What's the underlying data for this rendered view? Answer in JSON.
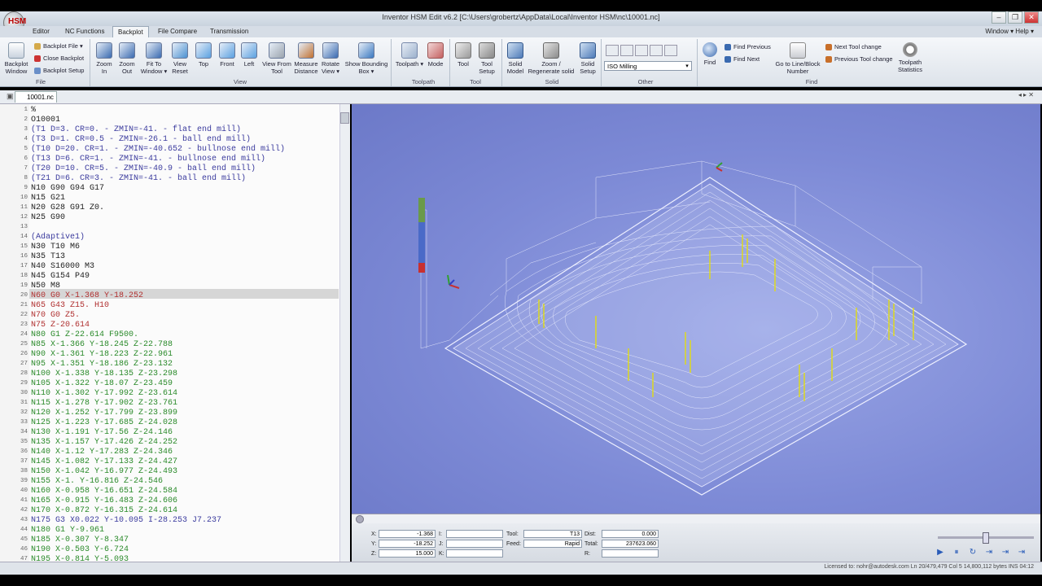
{
  "window": {
    "title": "Inventor HSM Edit v6.2    [C:\\Users\\grobertz\\AppData\\Local\\Inventor HSM\\nc\\10001.nc]",
    "controls": [
      "–",
      "❐",
      "✕"
    ]
  },
  "menu_tabs": [
    "Editor",
    "NC Functions",
    "Backplot",
    "File Compare",
    "Transmission"
  ],
  "menu_right": "Window ▾  Help ▾",
  "ribbon": {
    "file_group": {
      "label": "File",
      "backplot_window": "Backplot Window",
      "items": [
        "Backplot File ▾",
        "Close Backplot",
        "Backplot Setup"
      ]
    },
    "view_group": {
      "label": "View",
      "buttons": [
        "Zoom In",
        "Zoom Out",
        "Fit To Window ▾",
        "View Reset",
        "Top",
        "Front",
        "Left",
        "View From Tool",
        "Measure Distance",
        "Rotate View ▾",
        "Show Bounding Box ▾"
      ]
    },
    "toolpath_group": {
      "label": "Toolpath",
      "buttons": [
        "Toolpath ▾",
        "Mode"
      ]
    },
    "tool_group": {
      "label": "Tool",
      "buttons": [
        "Tool",
        "Tool Setup"
      ]
    },
    "solid_group": {
      "label": "Solid",
      "buttons": [
        "Solid Model",
        "Zoom / Regenerate solid",
        "Solid Setup"
      ]
    },
    "other_group": {
      "label": "Other",
      "combo_value": "ISO Milling"
    },
    "find_group": {
      "label": "Find",
      "buttons": [
        "Find",
        "Find Previous",
        "Find Next",
        "Go to Line/Block Number"
      ]
    },
    "toolchange_items": [
      "Next Tool change",
      "Previous Tool change"
    ],
    "stats_button": "Toolpath Statistics"
  },
  "doc_tab": "10001.nc",
  "code_lines": [
    {
      "n": "1",
      "t": "%",
      "c": "#222"
    },
    {
      "n": "2",
      "t": "O10001",
      "c": "#222"
    },
    {
      "n": "3",
      "t": "(T1 D=3. CR=0. - ZMIN=-41. - flat end mill)",
      "c": "#3b3b9e"
    },
    {
      "n": "4",
      "t": "(T3 D=1. CR=0.5 - ZMIN=-26.1 - ball end mill)",
      "c": "#3b3b9e"
    },
    {
      "n": "5",
      "t": "(T10 D=20. CR=1. - ZMIN=-40.652 - bullnose end mill)",
      "c": "#3b3b9e"
    },
    {
      "n": "6",
      "t": "(T13 D=6. CR=1. - ZMIN=-41. - bullnose end mill)",
      "c": "#3b3b9e"
    },
    {
      "n": "7",
      "t": "(T20 D=10. CR=5. - ZMIN=-40.9 - ball end mill)",
      "c": "#3b3b9e"
    },
    {
      "n": "8",
      "t": "(T21 D=6. CR=3. - ZMIN=-41. - ball end mill)",
      "c": "#3b3b9e"
    },
    {
      "n": "9",
      "t": "N10 G90 G94 G17",
      "c": "#222"
    },
    {
      "n": "10",
      "t": "N15 G21",
      "c": "#222"
    },
    {
      "n": "11",
      "t": "N20 G28 G91 Z0.",
      "c": "#222"
    },
    {
      "n": "12",
      "t": "N25 G90",
      "c": "#222"
    },
    {
      "n": "13",
      "t": "",
      "c": "#222"
    },
    {
      "n": "14",
      "t": "(Adaptive1)",
      "c": "#3b3b9e"
    },
    {
      "n": "15",
      "t": "N30 T10 M6",
      "c": "#222"
    },
    {
      "n": "16",
      "t": "N35 T13",
      "c": "#222"
    },
    {
      "n": "17",
      "t": "N40 S16000 M3",
      "c": "#222"
    },
    {
      "n": "18",
      "t": "N45 G154 P49",
      "c": "#222"
    },
    {
      "n": "19",
      "t": "N50 M8",
      "c": "#222"
    },
    {
      "n": "20",
      "t": "N60 G0 X-1.368 Y-18.252",
      "c": "#b03030"
    },
    {
      "n": "21",
      "t": "N65 G43 Z15. H10",
      "c": "#b03030"
    },
    {
      "n": "22",
      "t": "N70 G0 Z5.",
      "c": "#b03030"
    },
    {
      "n": "23",
      "t": "N75 Z-20.614",
      "c": "#b03030"
    },
    {
      "n": "24",
      "t": "N80 G1 Z-22.614 F9500.",
      "c": "#2a8a2a"
    },
    {
      "n": "25",
      "t": "N85 X-1.366 Y-18.245 Z-22.788",
      "c": "#2a8a2a"
    },
    {
      "n": "26",
      "t": "N90 X-1.361 Y-18.223 Z-22.961",
      "c": "#2a8a2a"
    },
    {
      "n": "27",
      "t": "N95 X-1.351 Y-18.186 Z-23.132",
      "c": "#2a8a2a"
    },
    {
      "n": "28",
      "t": "N100 X-1.338 Y-18.135 Z-23.298",
      "c": "#2a8a2a"
    },
    {
      "n": "29",
      "t": "N105 X-1.322 Y-18.07 Z-23.459",
      "c": "#2a8a2a"
    },
    {
      "n": "30",
      "t": "N110 X-1.302 Y-17.992 Z-23.614",
      "c": "#2a8a2a"
    },
    {
      "n": "31",
      "t": "N115 X-1.278 Y-17.902 Z-23.761",
      "c": "#2a8a2a"
    },
    {
      "n": "32",
      "t": "N120 X-1.252 Y-17.799 Z-23.899",
      "c": "#2a8a2a"
    },
    {
      "n": "33",
      "t": "N125 X-1.223 Y-17.685 Z-24.028",
      "c": "#2a8a2a"
    },
    {
      "n": "34",
      "t": "N130 X-1.191 Y-17.56 Z-24.146",
      "c": "#2a8a2a"
    },
    {
      "n": "35",
      "t": "N135 X-1.157 Y-17.426 Z-24.252",
      "c": "#2a8a2a"
    },
    {
      "n": "36",
      "t": "N140 X-1.12 Y-17.283 Z-24.346",
      "c": "#2a8a2a"
    },
    {
      "n": "37",
      "t": "N145 X-1.082 Y-17.133 Z-24.427",
      "c": "#2a8a2a"
    },
    {
      "n": "38",
      "t": "N150 X-1.042 Y-16.977 Z-24.493",
      "c": "#2a8a2a"
    },
    {
      "n": "39",
      "t": "N155 X-1. Y-16.816 Z-24.546",
      "c": "#2a8a2a"
    },
    {
      "n": "40",
      "t": "N160 X-0.958 Y-16.651 Z-24.584",
      "c": "#2a8a2a"
    },
    {
      "n": "41",
      "t": "N165 X-0.915 Y-16.483 Z-24.606",
      "c": "#2a8a2a"
    },
    {
      "n": "42",
      "t": "N170 X-0.872 Y-16.315 Z-24.614",
      "c": "#2a8a2a"
    },
    {
      "n": "43",
      "t": "N175 G3 X0.022 Y-10.095 I-28.253 J7.237",
      "c": "#3b3b9e"
    },
    {
      "n": "44",
      "t": "N180 G1 Y-9.961",
      "c": "#2a8a2a"
    },
    {
      "n": "45",
      "t": "N185 X-0.307 Y-8.347",
      "c": "#2a8a2a"
    },
    {
      "n": "46",
      "t": "N190 X-0.503 Y-6.724",
      "c": "#2a8a2a"
    },
    {
      "n": "47",
      "t": "N195 X-0.814 Y-5.093",
      "c": "#2a8a2a"
    }
  ],
  "status_panel": {
    "labels": {
      "x": "X:",
      "y": "Y:",
      "z": "Z:",
      "i": "I:",
      "j": "J:",
      "k": "K:",
      "tool": "Tool:",
      "feed": "Feed:",
      "dist": "Dist:",
      "total": "Total:",
      "r": "R:"
    },
    "x_value": "-1.368",
    "y_value": "-18.252",
    "z_value": "15.000",
    "tool_value": "T13",
    "feed_value": "Rapid",
    "dist_value": "0.000",
    "total_value": "237623.060"
  },
  "playback": [
    "▶",
    "⏸",
    "↻",
    "⇥",
    "⇥",
    "⇥"
  ],
  "status_bar": "Licensed to: nohr@autodesk.com    Ln 20/479,479    Col 5    14,800,112 bytes    INS    04:12"
}
